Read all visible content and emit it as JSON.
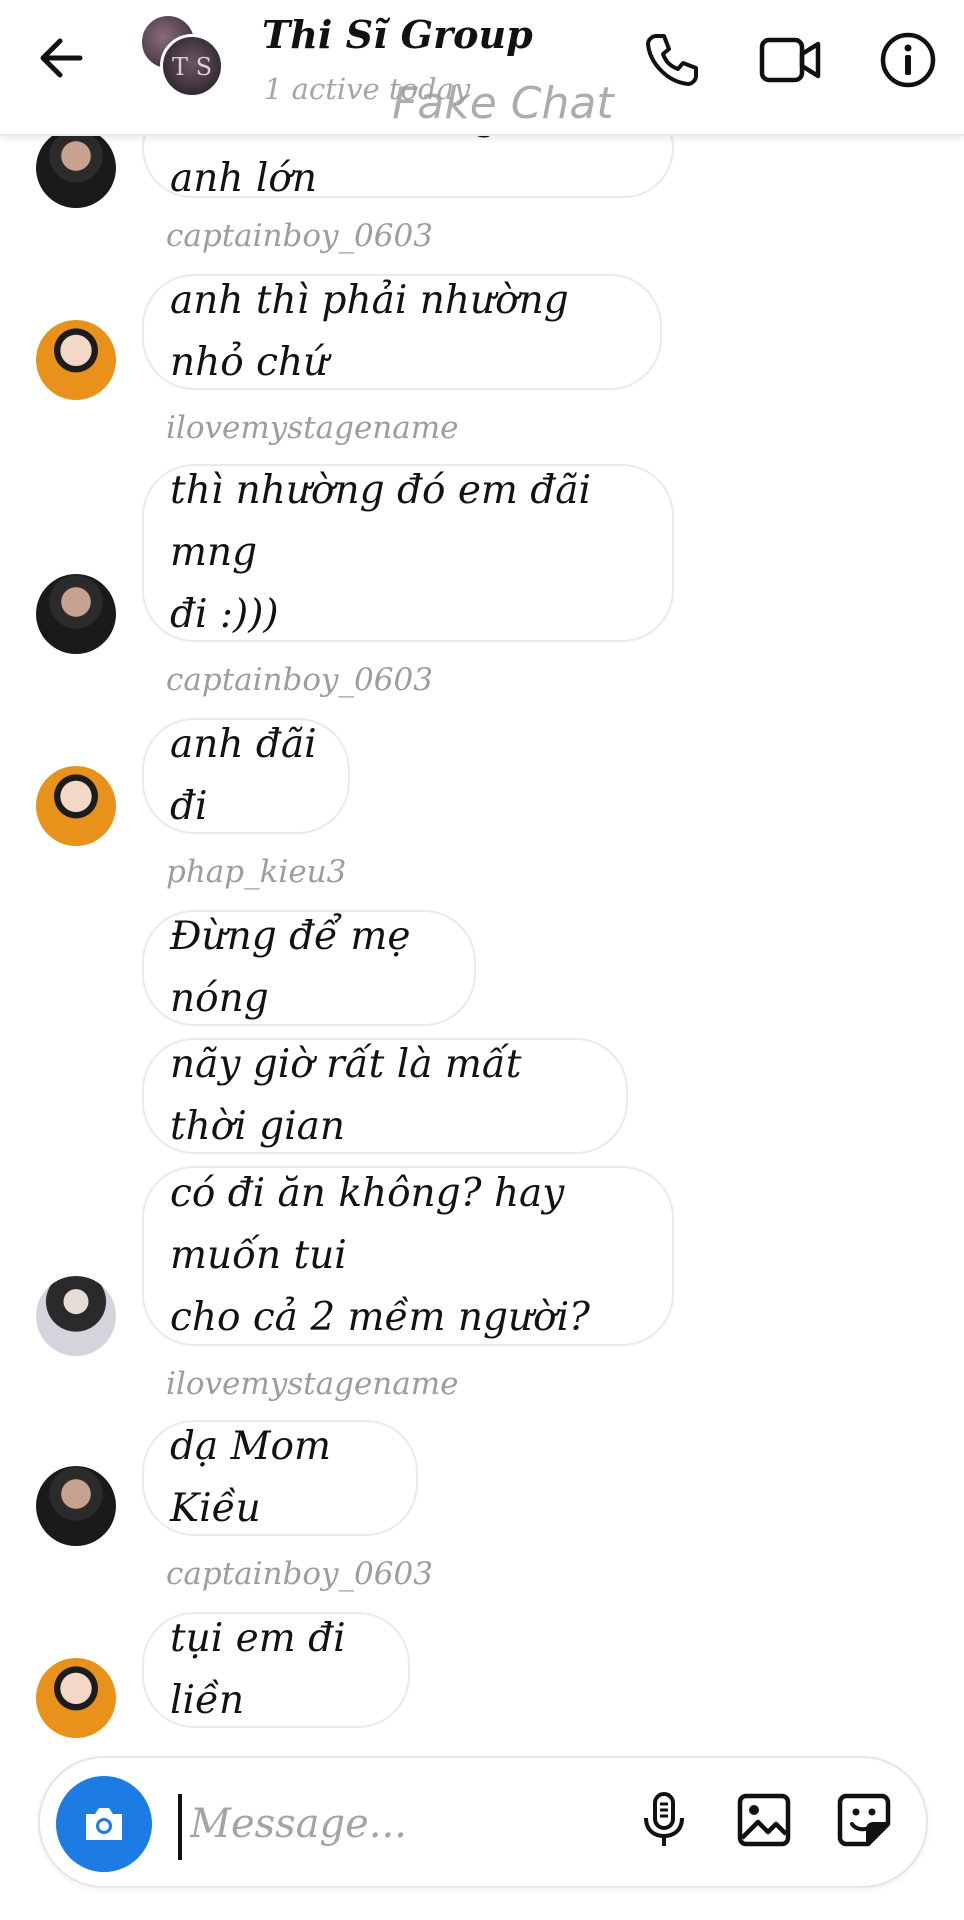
{
  "header": {
    "title": "Thi Sĩ Group",
    "status": "1 active today",
    "watermark": "Fake Chat",
    "group_avatar_text": "T S"
  },
  "messages": [
    {
      "type": "message",
      "text": "thôi em út thì nghe lời anh lớn",
      "avatar": "dark"
    },
    {
      "type": "sender",
      "text": "captainboy_0603"
    },
    {
      "type": "message",
      "text": "anh thì phải nhường nhỏ chứ",
      "avatar": "orange"
    },
    {
      "type": "sender",
      "text": "ilovemystagename"
    },
    {
      "type": "message",
      "text_lines": [
        "thì nhường đó em đãi mng",
        "đi :)))"
      ],
      "avatar": "dark"
    },
    {
      "type": "sender",
      "text": "captainboy_0603"
    },
    {
      "type": "message",
      "text": "anh đãi đi",
      "avatar": "orange"
    },
    {
      "type": "sender",
      "text": "phap_kieu3"
    },
    {
      "type": "message",
      "text": "Đừng để mẹ nóng"
    },
    {
      "type": "message",
      "text": "nãy giờ rất là mất thời gian"
    },
    {
      "type": "message",
      "text_lines": [
        "có đi ăn không? hay muốn tui",
        "cho cả 2 mềm người?"
      ],
      "avatar": "light"
    },
    {
      "type": "sender",
      "text": "ilovemystagename"
    },
    {
      "type": "message",
      "text": "dạ Mom Kiều",
      "avatar": "dark"
    },
    {
      "type": "sender",
      "text": "captainboy_0603"
    },
    {
      "type": "message",
      "text": "tụi em đi liền",
      "avatar": "orange"
    }
  ],
  "composer": {
    "placeholder": "Message..."
  },
  "icons": {
    "back": "arrow-left-icon",
    "call": "phone-icon",
    "video": "video-camera-icon",
    "info": "info-icon",
    "camera": "camera-icon",
    "mic": "microphone-icon",
    "gallery": "image-icon",
    "sticker": "sticker-icon"
  },
  "colors": {
    "accent": "#1d7ce4",
    "sender_name": "#9d9d9d",
    "bubble_border": "#e9e9ee"
  }
}
